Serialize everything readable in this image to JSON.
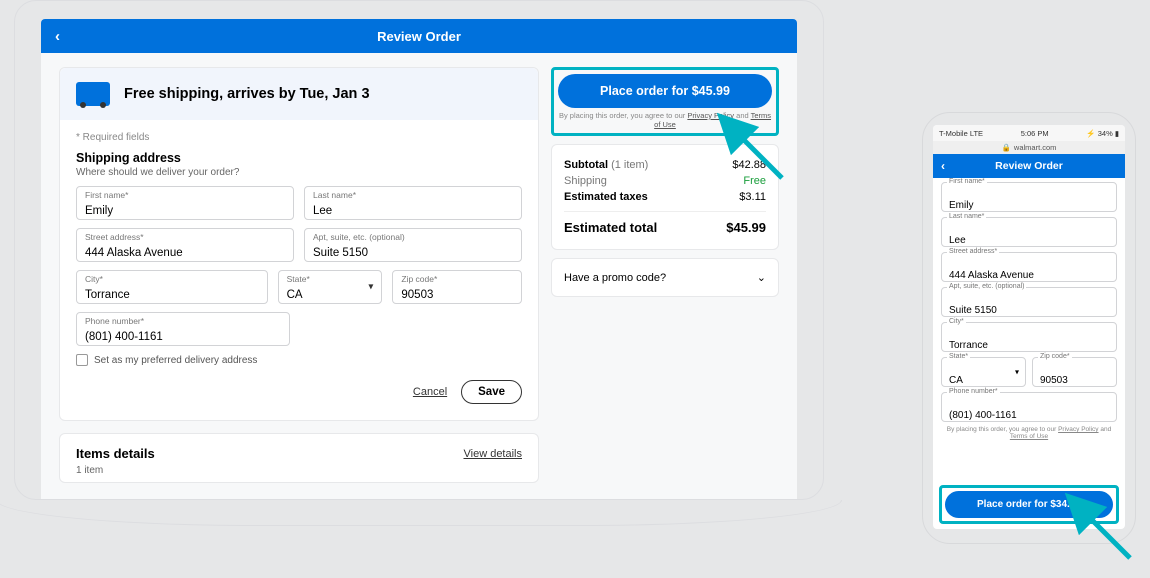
{
  "colors": {
    "brand": "#0071dc",
    "highlight": "#00b2c2",
    "success": "#1a9e3c"
  },
  "header": {
    "title": "Review Order"
  },
  "shipping_banner": "Free shipping, arrives by Tue, Jan 3",
  "form": {
    "required_note": "* Required fields",
    "section_title": "Shipping address",
    "section_sub": "Where should we deliver your order?",
    "fields": {
      "first_name": {
        "label": "First name*",
        "value": "Emily"
      },
      "last_name": {
        "label": "Last name*",
        "value": "Lee"
      },
      "street": {
        "label": "Street address*",
        "value": "444 Alaska Avenue"
      },
      "apt": {
        "label": "Apt, suite, etc. (optional)",
        "value": "Suite 5150"
      },
      "city": {
        "label": "City*",
        "value": "Torrance"
      },
      "state": {
        "label": "State*",
        "value": "CA"
      },
      "zip": {
        "label": "Zip code*",
        "value": "90503"
      },
      "phone": {
        "label": "Phone number*",
        "value": "(801) 400-1161"
      }
    },
    "preferred_checkbox": "Set as my preferred delivery address",
    "cancel": "Cancel",
    "save": "Save"
  },
  "items": {
    "heading": "Items details",
    "view_details": "View details",
    "count": "1 item"
  },
  "order": {
    "place_label": "Place order for $45.99",
    "agree_prefix": "By placing this order, you agree to our ",
    "pp": "Privacy Policy",
    "and": " and ",
    "tou": "Terms of Use",
    "subtotal_label": "Subtotal",
    "subtotal_qty": "(1 item)",
    "subtotal_value": "$42.88",
    "shipping_label": "Shipping",
    "shipping_value": "Free",
    "taxes_label": "Estimated taxes",
    "taxes_value": "$3.11",
    "total_label": "Estimated total",
    "total_value": "$45.99",
    "promo": "Have a promo code?"
  },
  "phone": {
    "status": {
      "carrier": "T-Mobile  LTE",
      "time": "5:06 PM",
      "battery": "34%"
    },
    "url": "walmart.com",
    "place_label": "Place order for $34.75"
  }
}
